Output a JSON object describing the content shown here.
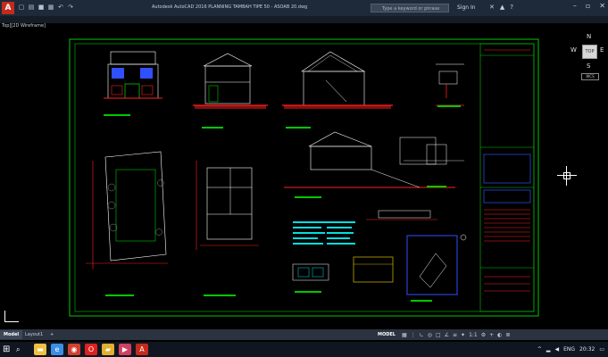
{
  "window": {
    "title": "Autodesk AutoCAD 2016    PLANNING TAMBAH TIPE 50 - ASOAB 20.dwg",
    "search_placeholder": "Type a keyword or phrase",
    "sign_in": "Sign In",
    "view_label": "-][Top][2D Wireframe]",
    "view_label_short": "Top][2D Wireframe]"
  },
  "viewcube": {
    "north": "N",
    "south": "S",
    "east": "E",
    "west": "W",
    "face": "TOP",
    "wcs": "WCS"
  },
  "layout_tabs": [
    {
      "label": "Model",
      "active": true
    },
    {
      "label": "Layout1",
      "active": false
    },
    {
      "label": "+",
      "active": false
    }
  ],
  "status": {
    "model": "MODEL",
    "scale": "1:1",
    "time": "20:32",
    "lang": "ENG"
  },
  "colors": {
    "frame": "#00c800",
    "red": "#ff2020",
    "white": "#ffffff",
    "cyan": "#00e0e0",
    "blue": "#3050ff",
    "magenta": "#e040e0",
    "yellow": "#ffe000"
  },
  "taskbar": {
    "apps": [
      {
        "icon": "file-explorer-icon",
        "color": "#f0c040"
      },
      {
        "icon": "edge-icon",
        "color": "#3a8ee6"
      },
      {
        "icon": "chrome-icon",
        "color": "#d04030"
      },
      {
        "icon": "opera-icon",
        "color": "#e02020"
      },
      {
        "icon": "files-icon",
        "color": "#e0b030"
      },
      {
        "icon": "media-icon",
        "color": "#d04060"
      },
      {
        "icon": "autocad-icon",
        "color": "#c42b1c"
      }
    ]
  }
}
